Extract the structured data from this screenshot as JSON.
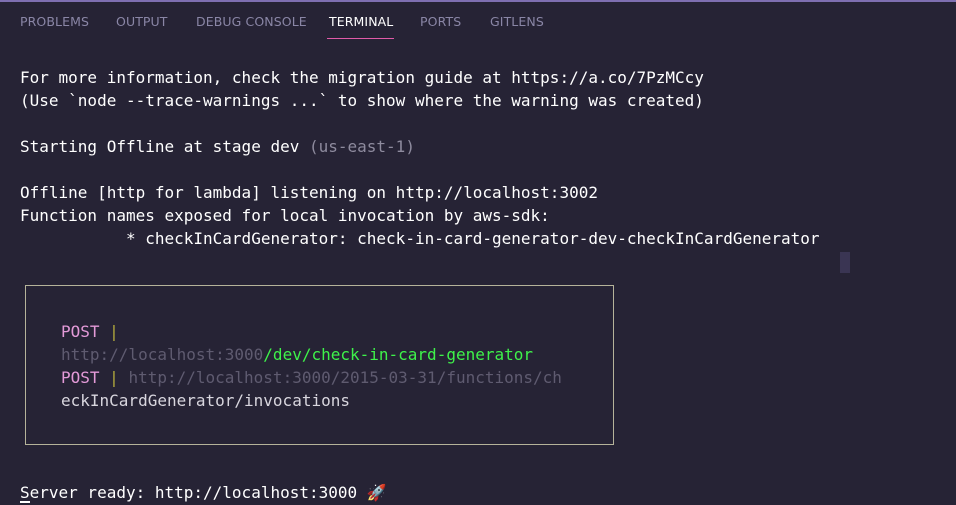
{
  "tabs": [
    {
      "label": "PROBLEMS",
      "active": false
    },
    {
      "label": "OUTPUT",
      "active": false
    },
    {
      "label": "DEBUG CONSOLE",
      "active": false
    },
    {
      "label": "TERMINAL",
      "active": true
    },
    {
      "label": "PORTS",
      "active": false
    },
    {
      "label": "GITLENS",
      "active": false
    }
  ],
  "terminal": {
    "line_migration": "For more information, check the migration guide at https://a.co/7PzMCcy",
    "line_trace": "(Use `node --trace-warnings ...` to show where the warning was created)",
    "line_starting": "Starting Offline at stage dev ",
    "line_starting_region": "(us-east-1)",
    "line_listening": "Offline [http for lambda] listening on http://localhost:3002",
    "line_function_names": "Function names exposed for local invocation by aws-sdk:",
    "line_function_item": "           * checkInCardGenerator: check-in-card-generator-dev-checkInCardGenerator",
    "server_ready": "Server ready: http://localhost:3000 🚀"
  },
  "routes_box": {
    "route1_method": "POST",
    "route1_sep": " |",
    "route1_base": "http://localhost:3000",
    "route1_path": "/dev/check-in-card-generator",
    "route2_method": "POST",
    "route2_sep": " | ",
    "route2_base_wrapped": "http://localhost:3000/2015-03-31/functions/ch",
    "route2_path_rest": "eckInCardGenerator/invocations"
  },
  "colors": {
    "background": "#262335",
    "active_tab_underline": "#e05ba8",
    "method": "#e39ad8",
    "path_highlight": "#3ef24a",
    "box_border": "#b5b39a"
  }
}
